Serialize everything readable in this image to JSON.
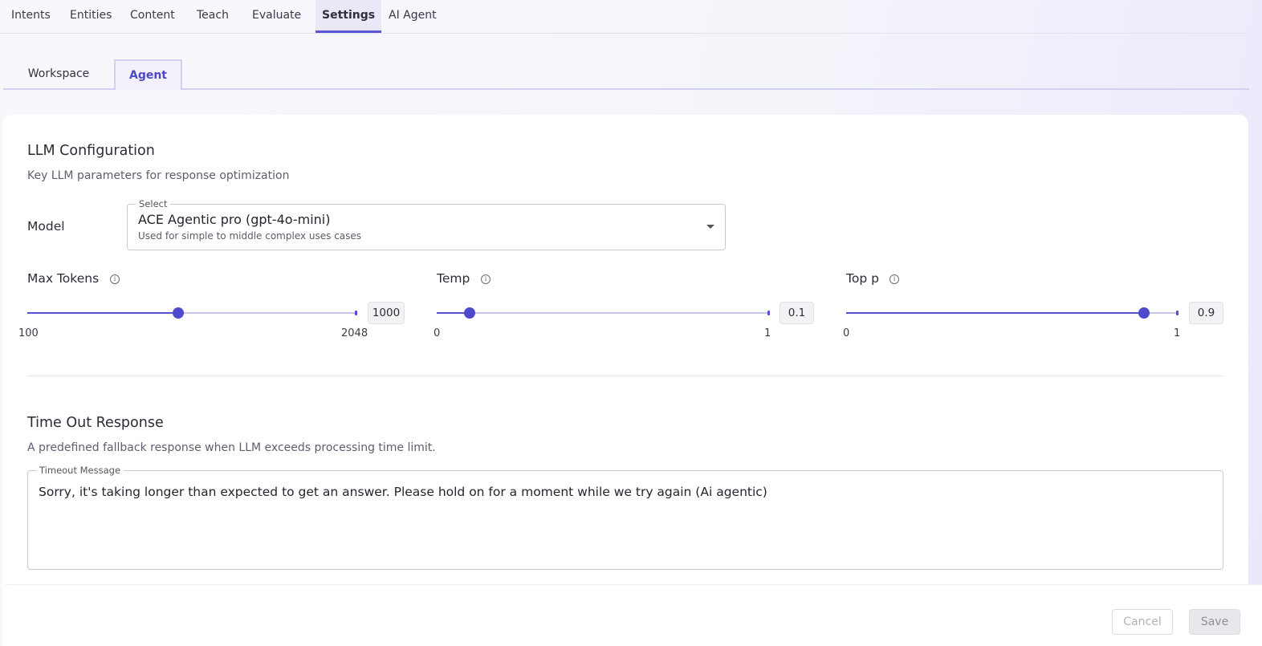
{
  "topnav": {
    "items": [
      {
        "label": "Intents"
      },
      {
        "label": "Entities"
      },
      {
        "label": "Content"
      },
      {
        "label": "Teach"
      },
      {
        "label": "Evaluate"
      },
      {
        "label": "Settings"
      },
      {
        "label": "AI Agent"
      }
    ],
    "active": "Settings"
  },
  "subtabs": {
    "workspace": "Workspace",
    "agent": "Agent",
    "active": "Agent"
  },
  "llm": {
    "title": "LLM Configuration",
    "description": "Key LLM parameters for response optimization",
    "model_label": "Model",
    "select_legend": "Select",
    "select_value": "ACE Agentic pro (gpt-4o-mini)",
    "select_subtext": "Used for simple to middle complex uses cases",
    "sliders": {
      "max_tokens": {
        "label": "Max Tokens",
        "min": "100",
        "max": "2048",
        "value": "1000",
        "fraction": 0.46
      },
      "temp": {
        "label": "Temp",
        "min": "0",
        "max": "1",
        "value": "0.1",
        "fraction": 0.1
      },
      "top_p": {
        "label": "Top p",
        "min": "0",
        "max": "1",
        "value": "0.9",
        "fraction": 0.9
      }
    },
    "info_glyph": "i"
  },
  "timeout": {
    "title": "Time Out Response",
    "description": "A predefined fallback response when LLM exceeds processing time limit.",
    "field_legend": "Timeout Message",
    "message": "Sorry, it's taking longer than expected to get an answer. Please hold on for a moment while we try again (Ai agentic)"
  },
  "footer": {
    "cancel": "Cancel",
    "save": "Save"
  },
  "colors": {
    "accent": "#5550cf",
    "track": "#c8c7ea"
  },
  "icons": {
    "info": "info-circle-icon",
    "dropdown": "caret-down-icon"
  }
}
